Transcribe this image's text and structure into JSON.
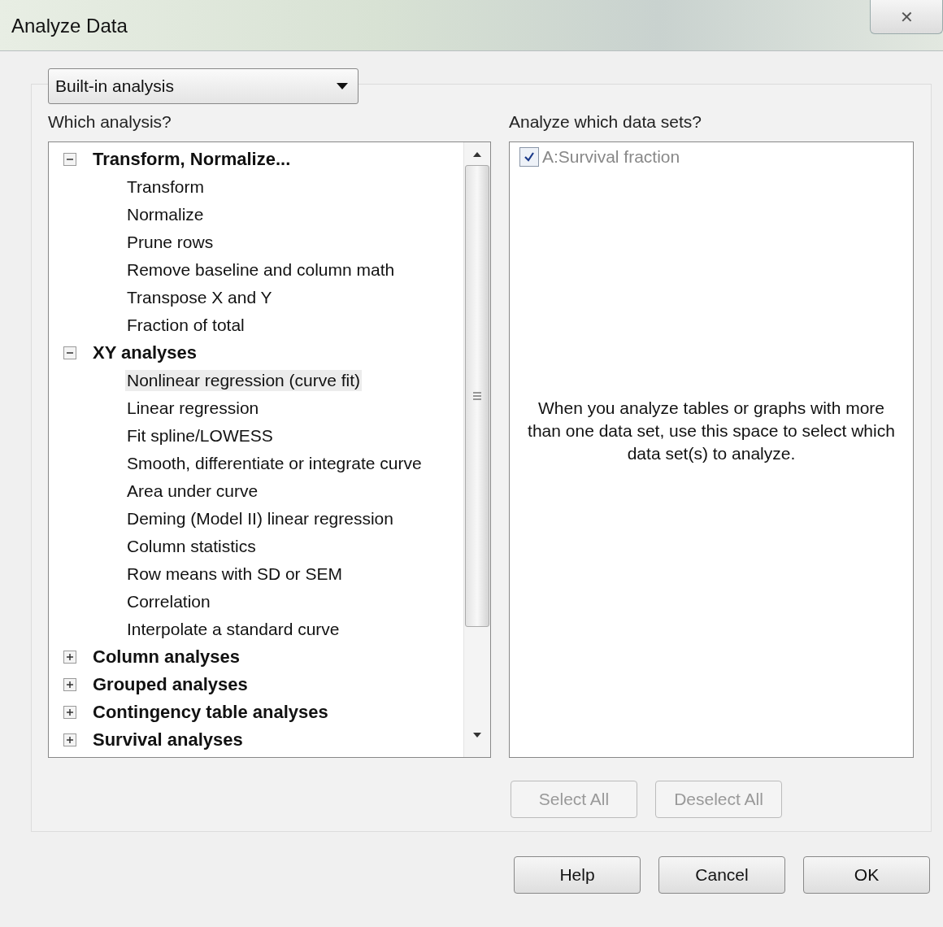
{
  "window": {
    "title": "Analyze Data",
    "close": "✕"
  },
  "analysis_type": {
    "value": "Built-in analysis"
  },
  "left_label": "Which analysis?",
  "right_label": "Analyze which data sets?",
  "tree": [
    {
      "label": "Transform, Normalize...",
      "expanded": true,
      "children": [
        {
          "label": "Transform",
          "selected": false
        },
        {
          "label": "Normalize",
          "selected": false
        },
        {
          "label": "Prune rows",
          "selected": false
        },
        {
          "label": "Remove baseline and column math",
          "selected": false
        },
        {
          "label": "Transpose X and Y",
          "selected": false
        },
        {
          "label": "Fraction of total",
          "selected": false
        }
      ]
    },
    {
      "label": "XY analyses",
      "expanded": true,
      "children": [
        {
          "label": "Nonlinear regression (curve fit)",
          "selected": true
        },
        {
          "label": "Linear regression",
          "selected": false
        },
        {
          "label": "Fit spline/LOWESS",
          "selected": false
        },
        {
          "label": "Smooth, differentiate or integrate curve",
          "selected": false
        },
        {
          "label": "Area under curve",
          "selected": false
        },
        {
          "label": "Deming (Model II) linear regression",
          "selected": false
        },
        {
          "label": "Column statistics",
          "selected": false
        },
        {
          "label": "Row means with SD or SEM",
          "selected": false
        },
        {
          "label": "Correlation",
          "selected": false
        },
        {
          "label": "Interpolate a standard curve",
          "selected": false
        }
      ]
    },
    {
      "label": "Column analyses",
      "expanded": false
    },
    {
      "label": "Grouped analyses",
      "expanded": false
    },
    {
      "label": "Contingency table analyses",
      "expanded": false
    },
    {
      "label": "Survival analyses",
      "expanded": false
    }
  ],
  "data_sets": [
    {
      "label": "A:Survival fraction",
      "checked": true
    }
  ],
  "data_sets_hint": "When you analyze tables or graphs with more than one data set, use this space to select which data set(s) to analyze.",
  "selection_buttons": [
    {
      "label": "Select All",
      "disabled": true
    },
    {
      "label": "Deselect All",
      "disabled": true
    }
  ],
  "buttons": [
    "Help",
    "Cancel",
    "OK"
  ]
}
